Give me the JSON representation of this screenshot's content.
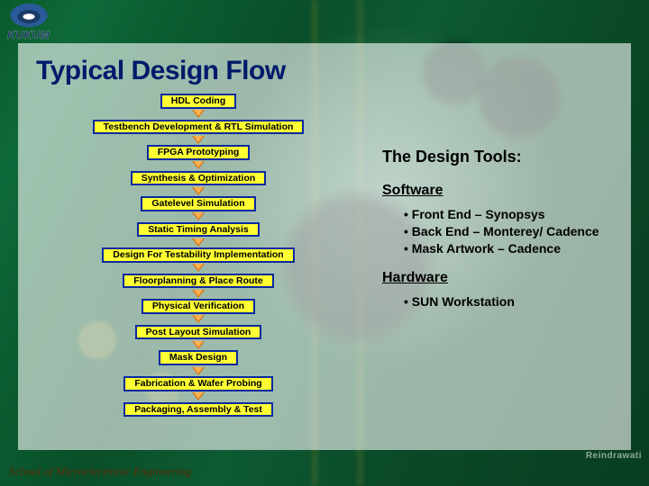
{
  "logo": {
    "text": "KUKUM"
  },
  "title": "Typical Design Flow",
  "flow_steps": [
    "HDL Coding",
    "Testbench Development & RTL Simulation",
    "FPGA Prototyping",
    "Synthesis & Optimization",
    "Gatelevel Simulation",
    "Static Timing Analysis",
    "Design For Testability Implementation",
    "Floorplanning & Place Route",
    "Physical Verification",
    "Post Layout Simulation",
    "Mask Design",
    "Fabrication & Wafer Probing",
    "Packaging, Assembly & Test"
  ],
  "tools": {
    "heading": "The Design Tools:",
    "software_label": "Software",
    "software_items": [
      "• Front End – Synopsys",
      "• Back End – Monterey/ Cadence",
      "• Mask Artwork – Cadence"
    ],
    "hardware_label": "Hardware",
    "hardware_items": [
      "• SUN Workstation"
    ]
  },
  "watermark": "Reindrawati",
  "footer": "School of Microelectronic Engineering"
}
